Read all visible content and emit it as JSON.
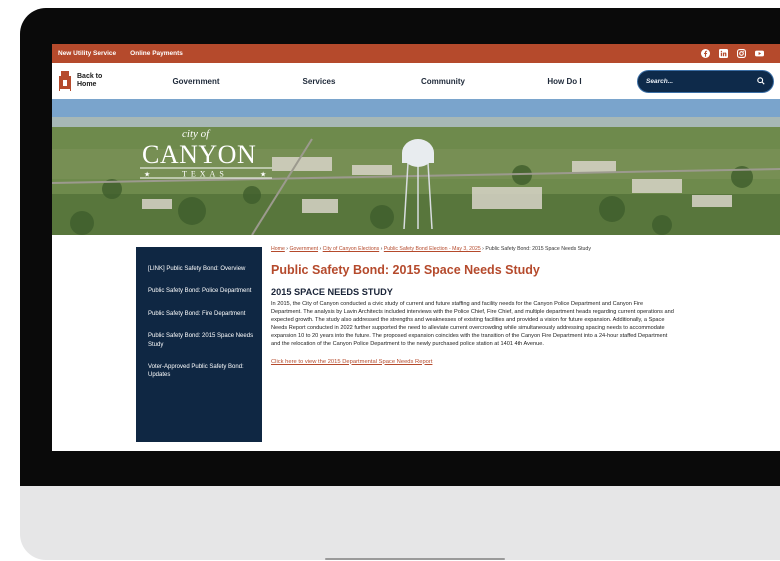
{
  "utility_bar": {
    "links": [
      "New Utility Service",
      "Online Payments"
    ],
    "social": [
      "facebook-icon",
      "linkedin-icon",
      "instagram-icon",
      "youtube-icon"
    ]
  },
  "nav": {
    "home_label_1": "Back to",
    "home_label_2": "Home",
    "items": [
      "Government",
      "Services",
      "Community",
      "How Do I"
    ],
    "search_placeholder": "Search..."
  },
  "hero": {
    "logo_top": "city of",
    "logo_main": "CANYON",
    "logo_sub": "TEXAS"
  },
  "sidebar": {
    "items": [
      "[LINK] Public Safety Bond: Overview",
      "Public Safety Bond: Police Department",
      "Public Safety Bond: Fire Department",
      "Public Safety Bond: 2015 Space Needs Study",
      "Voter-Approved Public Safety Bond: Updates"
    ]
  },
  "breadcrumb": {
    "links": [
      "Home",
      "Government",
      "City of Canyon Elections",
      "Public Safety Bond Election - May 3, 2025"
    ],
    "separator": "›",
    "current": "Public Safety Bond: 2015 Space Needs Study"
  },
  "main": {
    "title": "Public Safety Bond: 2015 Space Needs Study",
    "section_title": "2015 SPACE NEEDS STUDY",
    "body": "In 2015, the City of Canyon conducted a civic study of current and future staffing and facility needs for the Canyon Police Department and Canyon Fire Department. The analysis by Lavin Architects included interviews with the Police Chief, Fire Chief, and multiple department heads regarding current operations and expected growth. The study also addressed the strengths and weaknesses of existing facilities and provided a vision for future expansion. Additionally, a Space Needs Report conducted in 2022 further supported the need to alleviate current overcrowding while simultaneously addressing spacing needs to accommodate expansion 10 to 20 years into the future. The proposed expansion coincides with the transition of the Canyon Fire Department into a 24-hour staffed Department and the relocation of the Canyon Police Department to the newly purchased police station at 1401 4th Avenue.",
    "report_link": "Click here to view the 2015 Departmental Space Needs Report"
  },
  "colors": {
    "brand_red": "#b54a2c",
    "navy": "#0f2743"
  }
}
